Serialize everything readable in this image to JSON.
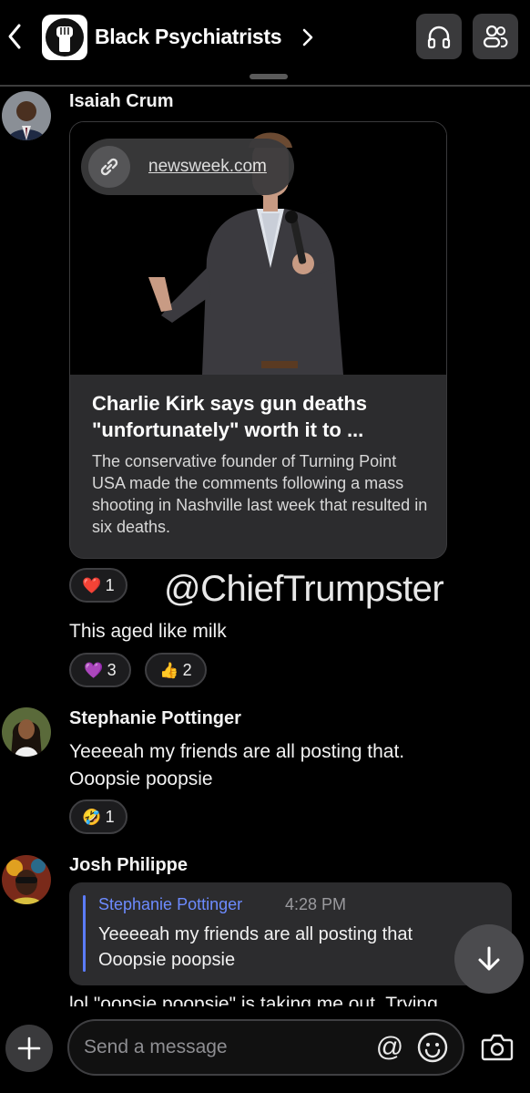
{
  "header": {
    "group_name": "Black Psychiatrists",
    "back_icon": "chevron-left-icon",
    "audio_icon": "headphones-icon",
    "members_icon": "members-icon"
  },
  "messages": [
    {
      "sender": "Isaiah Crum",
      "link_preview": {
        "domain": "newsweek.com",
        "title": "Charlie Kirk says gun deaths \"unfortunately\" worth it to ...",
        "description": "The conservative founder of Turning Point USA made the comments following a mass shooting in Nashville last week that resulted in six deaths."
      },
      "link_reactions": [
        {
          "emoji": "❤️",
          "count": "1"
        }
      ],
      "text": "This aged like milk",
      "text_reactions": [
        {
          "emoji": "💜",
          "count": "3"
        },
        {
          "emoji": "👍",
          "count": "2"
        }
      ]
    },
    {
      "sender": "Stephanie Pottinger",
      "text_line1": "Yeeeeah my friends are all posting that.",
      "text_line2": "Ooopsie poopsie",
      "reactions": [
        {
          "emoji": "🤣",
          "count": "1"
        }
      ]
    },
    {
      "sender": "Josh Philippe",
      "quote": {
        "author": "Stephanie Pottinger",
        "time": "4:28 PM",
        "line1": "Yeeeeah my friends are all posting that",
        "line2": "Ooopsie poopsie"
      },
      "text_partial": "lol \"oopsie poopsie\" is taking me out. Trying"
    }
  ],
  "watermark": "@ChiefTrumpster",
  "composer": {
    "placeholder": "Send a message",
    "mention_symbol": "@"
  },
  "colors": {
    "background": "#000000",
    "surface": "#2c2c2e",
    "accent": "#6d8bff"
  }
}
